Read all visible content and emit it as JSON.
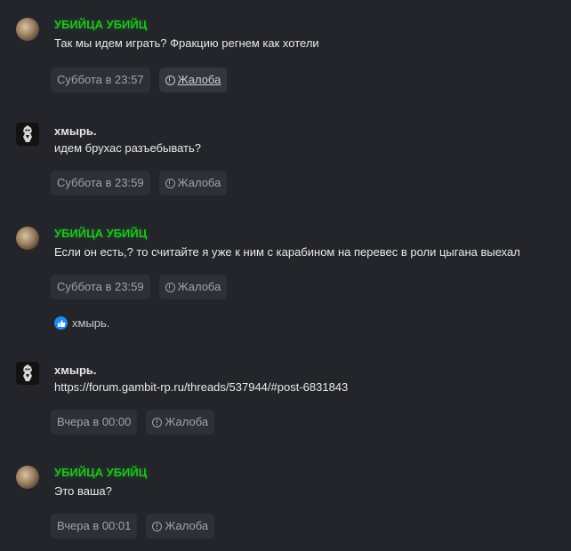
{
  "messages": [
    {
      "author": "УБИЙЦА УБИЙЦ",
      "text": "Так мы идем играть? Фракцию регнем как хотели",
      "time": "Суббота в 23:57",
      "report": "Жалоба"
    },
    {
      "author": "хмырь.",
      "text": "идем брухас разъебывать?",
      "time": "Суббота в 23:59",
      "report": "Жалоба"
    },
    {
      "author": "УБИЙЦА УБИЙЦ",
      "text": "Если он есть,? то считайте я уже к ним с карабином на перевес в роли цыгана выехал",
      "time": "Суббота в 23:59",
      "report": "Жалоба",
      "reaction_user": "хмырь."
    },
    {
      "author": "хмырь.",
      "text": "https://forum.gambit-rp.ru/threads/537944/#post-6831843",
      "time": "Вчера в 00:00",
      "report": "Жалоба"
    },
    {
      "author": "УБИЙЦА УБИЙЦ",
      "text": "Это ваша?",
      "time": "Вчера в 00:01",
      "report": "Жалоба"
    }
  ],
  "colors": {
    "background": "#23252b",
    "chip": "#2e3036",
    "author_green": "#1ec31e",
    "like_blue": "#1d8cf0"
  },
  "icons": {
    "report": "exclamation-circle-icon",
    "reaction": "thumbs-up-icon"
  }
}
